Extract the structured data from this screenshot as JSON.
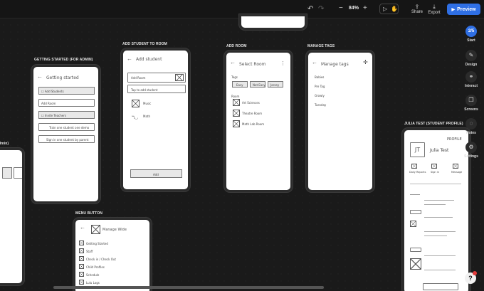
{
  "toolbar": {
    "undo_icon": "undo-icon",
    "redo_icon": "redo-icon",
    "zoom_out": "−",
    "zoom_level": "84%",
    "zoom_in": "+",
    "share_label": "Share",
    "export_label": "Export",
    "preview_label": "Preview"
  },
  "sidebar": {
    "progress": "2/5",
    "start_label": "Start",
    "design_label": "Design",
    "interact_label": "Interact",
    "screens_label": "Screens",
    "notes_label": "Notes",
    "settings_label": "Settings"
  },
  "frames": {
    "getting_started": {
      "label": "GETTING STARTED (FOR ADMIN)",
      "header": "Getting started",
      "items": [
        "Add Students",
        "Add Room",
        "Invite Teachers",
        "Train  one student one demo",
        "Sign in  one student by parent"
      ]
    },
    "add_student": {
      "label": "ADD STUDENT TO ROOM",
      "header": "Add student",
      "search": "Add Room",
      "tap_text": "Tap to add student",
      "item1": "Music",
      "item2": "Math",
      "button": "Add"
    },
    "add_room": {
      "label": "ADD ROOM",
      "header": "Select Room",
      "tags_title": "Tags",
      "tags": [
        "Easy",
        "Not Easy",
        "Jarsey"
      ],
      "rooms_title": "Room",
      "rooms": [
        "Art Sciences",
        "Theatre Room",
        "Math Lab Room"
      ]
    },
    "manage_tags": {
      "label": "MANAGE TAGS",
      "header": "Manage tags",
      "items": [
        "Babies",
        "Pre Tag",
        "Growly",
        "Tuesday"
      ]
    },
    "menu_button": {
      "label": "MENU BUTTON",
      "header": "Manage Wide",
      "items": [
        "Getting Started",
        "Staff",
        "Check in / Check Out",
        "Child Profiles",
        "Schedule",
        "Lulu Logs"
      ]
    },
    "julia": {
      "label": "JULIA TEST (STUDENT PROFILE)",
      "title": "PROFILE",
      "initials": "JT",
      "name": "Julia Test",
      "actions": [
        "Daily Reports",
        "Sign in",
        "Message"
      ]
    }
  }
}
